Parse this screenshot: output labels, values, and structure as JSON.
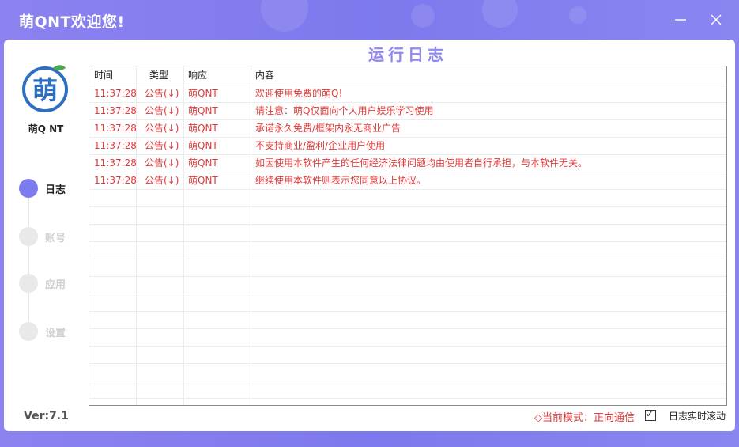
{
  "window": {
    "title": "萌QNT欢迎您!",
    "colors": {
      "frame": "#7d79ee",
      "accent": "#7d7bf0",
      "red": "#e03a3a",
      "title_purple": "#8f88ee"
    }
  },
  "brand": {
    "logo_icon": "logo-meng-icon",
    "logo_glyph": "萌",
    "name": "萌Q NT"
  },
  "nav": {
    "items": [
      {
        "label": "日志",
        "active": true
      },
      {
        "label": "账号",
        "active": false
      },
      {
        "label": "应用",
        "active": false
      },
      {
        "label": "设置",
        "active": false
      }
    ]
  },
  "version": "Ver:7.1",
  "log": {
    "title": "运行日志",
    "columns": {
      "time": "时间",
      "type": "类型",
      "response": "响应",
      "content": "内容"
    },
    "rows": [
      {
        "time": "11:37:28",
        "type": "公告(↓)",
        "response": "萌QNT",
        "content": "欢迎使用免费的萌Q!"
      },
      {
        "time": "11:37:28",
        "type": "公告(↓)",
        "response": "萌QNT",
        "content": "请注意：萌Q仅面向个人用户娱乐学习使用"
      },
      {
        "time": "11:37:28",
        "type": "公告(↓)",
        "response": "萌QNT",
        "content": "承诺永久免费/框架内永无商业广告"
      },
      {
        "time": "11:37:28",
        "type": "公告(↓)",
        "response": "萌QNT",
        "content": "不支持商业/盈利/企业用户使用"
      },
      {
        "time": "11:37:28",
        "type": "公告(↓)",
        "response": "萌QNT",
        "content": "如因使用本软件产生的任何经济法律问题均由使用者自行承担，与本软件无关。"
      },
      {
        "time": "11:37:28",
        "type": "公告(↓)",
        "response": "萌QNT",
        "content": "继续使用本软件则表示您同意以上协议。"
      }
    ]
  },
  "status": {
    "mode": "◇当前模式：正向通信",
    "autoscroll_label": "日志实时滚动",
    "autoscroll_checked": true
  }
}
